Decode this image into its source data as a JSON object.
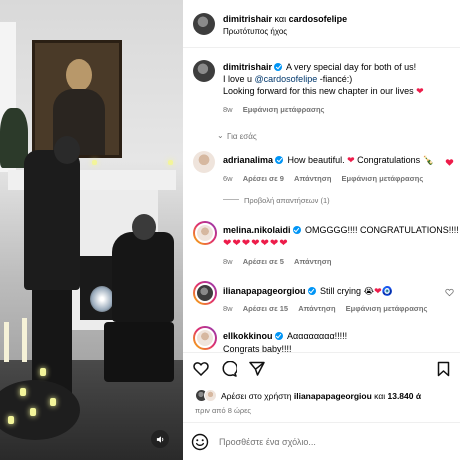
{
  "header": {
    "author": "dimitrishair",
    "joiner": "και",
    "coauthor": "cardosofelipe",
    "audio": "Πρωτότυπος ήχος",
    "more_icon": "more-dots-icon"
  },
  "caption": {
    "author": "dimitrishair",
    "line1": "A very special day for both of us!",
    "line2_prefix": "I love u ",
    "mention": "@cardosofelipe",
    "line2_suffix": " -fiancé:)",
    "line3": "Looking forward for this new chapter in our lives",
    "time": "8w",
    "translate": "Εμφάνιση μετάφρασης"
  },
  "for_you": "Για εσάς",
  "comments": [
    {
      "user": "adrianalima",
      "text": "How beautiful. ",
      "text2": " Congratulations ",
      "emojis": "❤",
      "time": "6w",
      "likes": "Αρέσει σε 9",
      "reply": "Απάντηση",
      "translate": "Εμφάνιση μετάφρασης"
    },
    {
      "user": "melina.nikolaidi",
      "text": "OMGGGG!!!! CONGRATULATIONS!!!!",
      "hearts": "❤❤❤❤❤❤❤",
      "time": "8w",
      "likes": "Αρέσει σε 5",
      "reply": "Απάντηση"
    },
    {
      "user": "ilianapapageorgiou",
      "text": "Still crying ",
      "time": "8w",
      "likes": "Αρέσει σε 15",
      "reply": "Απάντηση",
      "translate": "Εμφάνιση μετάφρασης"
    },
    {
      "user": "ellkokkinou",
      "text": "Ααααααααα!!!!!",
      "text2": "Congrats baby!!!!"
    }
  ],
  "view_replies": "Προβολή απαντήσεων (1)",
  "likes_line": {
    "prefix": "Αρέσει στο χρήστη ",
    "user": "ilianapapageorgiou",
    "middle": " και ",
    "count": "13.840 ά"
  },
  "post_time": "πριν από 8 ώρες",
  "comment_placeholder": "Προσθέστε ένα σχόλιο...",
  "colors": {
    "heart": "#ed1c4a",
    "verified": "#0095f6",
    "muted": "#737373"
  }
}
